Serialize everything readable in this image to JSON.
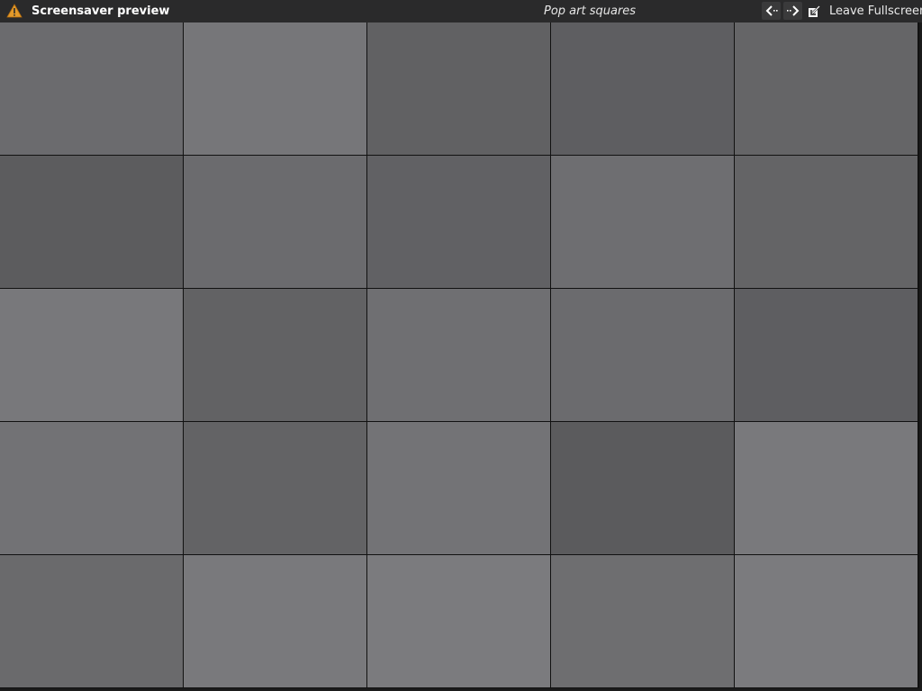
{
  "topbar": {
    "title": "Screensaver preview",
    "subtitle": "Pop art squares",
    "leave_label": "Leave Fullscreen",
    "icons": [
      "warning-icon",
      "arrow-left-icon",
      "arrow-right-icon",
      "leave-fullscreen-icon"
    ]
  },
  "tiles": {
    "rows": [
      [
        "#6b6b6e",
        "#767679",
        "#616163",
        "#5e5e61",
        "#656567"
      ],
      [
        "#5c5c5e",
        "#6b6b6e",
        "#616164",
        "#6e6e71",
        "#646466"
      ],
      [
        "#78787b",
        "#626264",
        "#6f6f72",
        "#6b6b6e",
        "#5e5e61"
      ],
      [
        "#727275",
        "#636365",
        "#737376",
        "#5b5b5d",
        "#79797c"
      ],
      [
        "#6a6a6c",
        "#79797c",
        "#7b7b7e",
        "#6e6e70",
        "#7b7b7e"
      ]
    ]
  }
}
